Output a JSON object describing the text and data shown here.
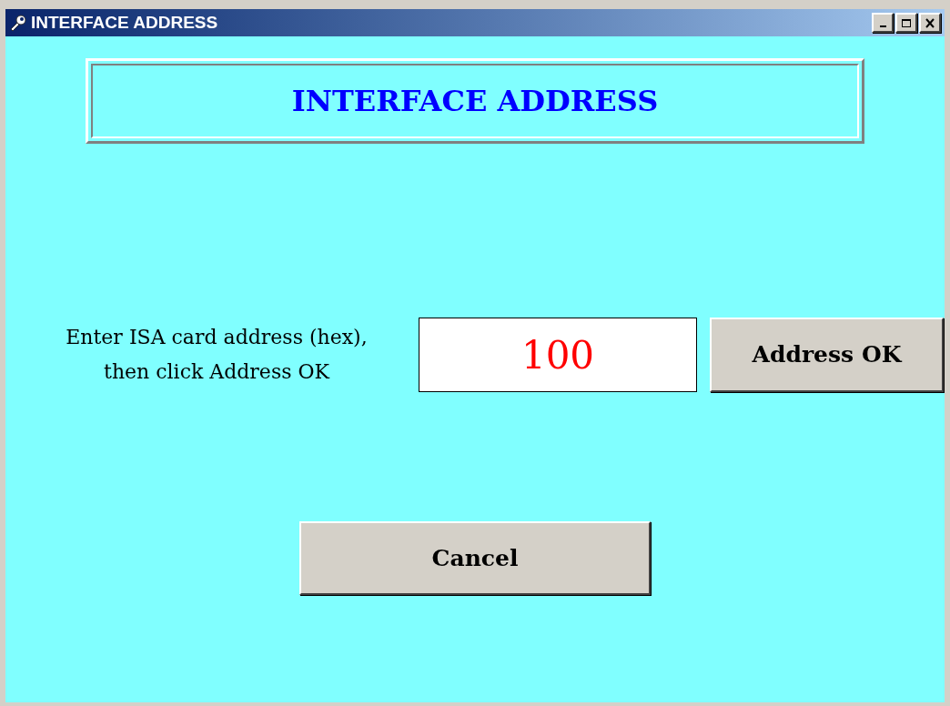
{
  "window": {
    "title": "INTERFACE ADDRESS"
  },
  "heading": "INTERFACE ADDRESS",
  "prompt": {
    "lines": [
      "Enter ISA card address (hex),",
      "then click Address OK"
    ]
  },
  "address_field": {
    "value": "100"
  },
  "buttons": [
    {
      "kind": "address_ok",
      "label": "Address OK"
    },
    {
      "kind": "cancel",
      "label": "Cancel"
    }
  ]
}
